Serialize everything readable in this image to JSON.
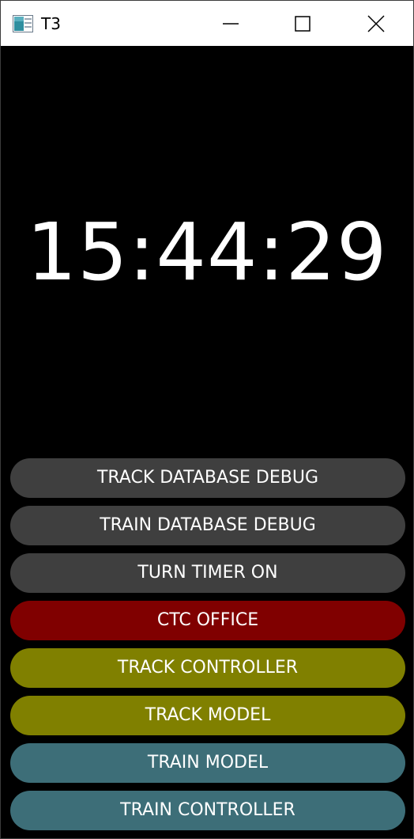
{
  "window": {
    "title": "T3"
  },
  "clock": {
    "time": "15:44:29"
  },
  "buttons": [
    {
      "label": "TRACK DATABASE DEBUG",
      "color": "#3f3f3f"
    },
    {
      "label": "TRAIN DATABASE DEBUG",
      "color": "#3f3f3f"
    },
    {
      "label": "TURN TIMER ON",
      "color": "#3f3f3f"
    },
    {
      "label": "CTC OFFICE",
      "color": "#800000"
    },
    {
      "label": "TRACK CONTROLLER",
      "color": "#808000"
    },
    {
      "label": "TRACK MODEL",
      "color": "#808000"
    },
    {
      "label": "TRAIN MODEL",
      "color": "#3d6e78"
    },
    {
      "label": "TRAIN CONTROLLER",
      "color": "#3d6e78"
    }
  ],
  "icons": {
    "app": "app-window-icon",
    "minimize": "minimize-icon",
    "maximize": "maximize-icon",
    "close": "close-icon"
  }
}
